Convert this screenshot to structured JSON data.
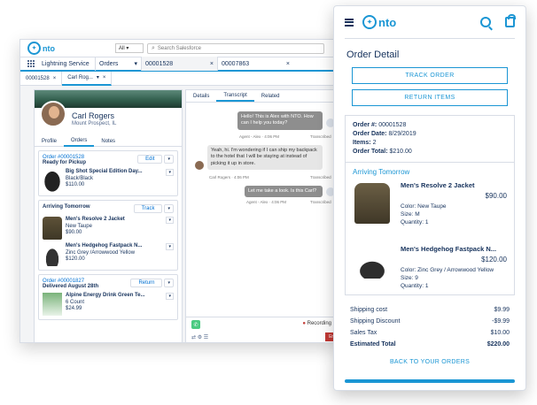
{
  "console": {
    "brand": "nto",
    "search_scope": "All",
    "search_placeholder": "Search Salesforce",
    "app_name": "Lightning Service",
    "nav_object": "Orders",
    "nav_tabs": [
      "00001528",
      "00007863"
    ],
    "sub_tabs": [
      "00001528",
      "Carl Rog..."
    ],
    "customer": {
      "name": "Carl Rogers",
      "location": "Mount Prospect, IL"
    },
    "left_tabs": [
      "Profile",
      "Orders",
      "Notes"
    ],
    "orders": [
      {
        "number": "Order #00001528",
        "status": "Ready for Pickup",
        "action": "Edit",
        "items": [
          {
            "name": "Big Shot Special Edition Day...",
            "detail": "Black/Black",
            "price": "$110.00"
          }
        ]
      },
      {
        "number": "",
        "status": "Arriving Tomorrow",
        "action": "Track",
        "items": [
          {
            "name": "Men's Resolve 2 Jacket",
            "detail": "New Taupe",
            "price": "$90.00"
          },
          {
            "name": "Men's Hedgehog Fastpack N...",
            "detail": "Zinc Grey /Arrowwood Yellow",
            "price": "$120.00"
          }
        ]
      },
      {
        "number": "Order #00001827",
        "status": "Delivered August 28th",
        "action": "Return",
        "items": [
          {
            "name": "Alpine Energy Drink Green Te...",
            "detail": "6 Count",
            "price": "$24.99"
          }
        ]
      }
    ],
    "right_tabs": [
      "Details",
      "Transcript",
      "Related"
    ],
    "messages": [
      {
        "from": "agent",
        "text": "Hello! This is Alex with NTO. How can I help you today?",
        "meta_left": "Agent - Alex · 4:06 PM",
        "meta_right": "Transcribed"
      },
      {
        "from": "customer",
        "text": "Yeah, hi. I'm wondering if I can ship my backpack to the hotel that I will be staying at instead of picking it up in store.",
        "meta_left": "Carl Rogers · 4:06 PM",
        "meta_right": "Transcribed"
      },
      {
        "from": "agent",
        "text": "Let me take a look. Is this Carl?",
        "meta_left": "Agent - Alex · 4:06 PM",
        "meta_right": "Transcribed"
      }
    ],
    "recording_label": "Recording",
    "end_label": "End"
  },
  "mobile": {
    "brand": "nto",
    "title": "Order Detail",
    "buttons": {
      "track": "TRACK ORDER",
      "returns": "RETURN ITEMS"
    },
    "order": {
      "number_label": "Order #:",
      "number": "00001528",
      "date_label": "Order Date:",
      "date": "8/29/2019",
      "items_label": "Items:",
      "items": "2",
      "total_label": "Order Total:",
      "total": "$210.00"
    },
    "arriving": "Arriving Tomorrow",
    "products": [
      {
        "name": "Men's Resolve 2 Jacket",
        "price": "$90.00",
        "color": "Color: New Taupe",
        "size": "Size: M",
        "qty": "Quantity: 1"
      },
      {
        "name": "Men's Hedgehog Fastpack N...",
        "price": "$120.00",
        "color": "Color: Zinc Grey / Arrowwood Yellow",
        "size": "Size: 9",
        "qty": "Quantity: 1"
      }
    ],
    "totals": [
      {
        "label": "Shipping cost",
        "value": "$9.99"
      },
      {
        "label": "Shipping Discount",
        "value": "-$9.99"
      },
      {
        "label": "Sales Tax",
        "value": "$10.00"
      },
      {
        "label": "Estimated Total",
        "value": "$220.00"
      }
    ],
    "back_link": "BACK TO YOUR ORDERS"
  },
  "colors": {
    "accent": "#1b96d4",
    "link": "#0070d2",
    "text": "#16325c",
    "end": "#c23934"
  }
}
